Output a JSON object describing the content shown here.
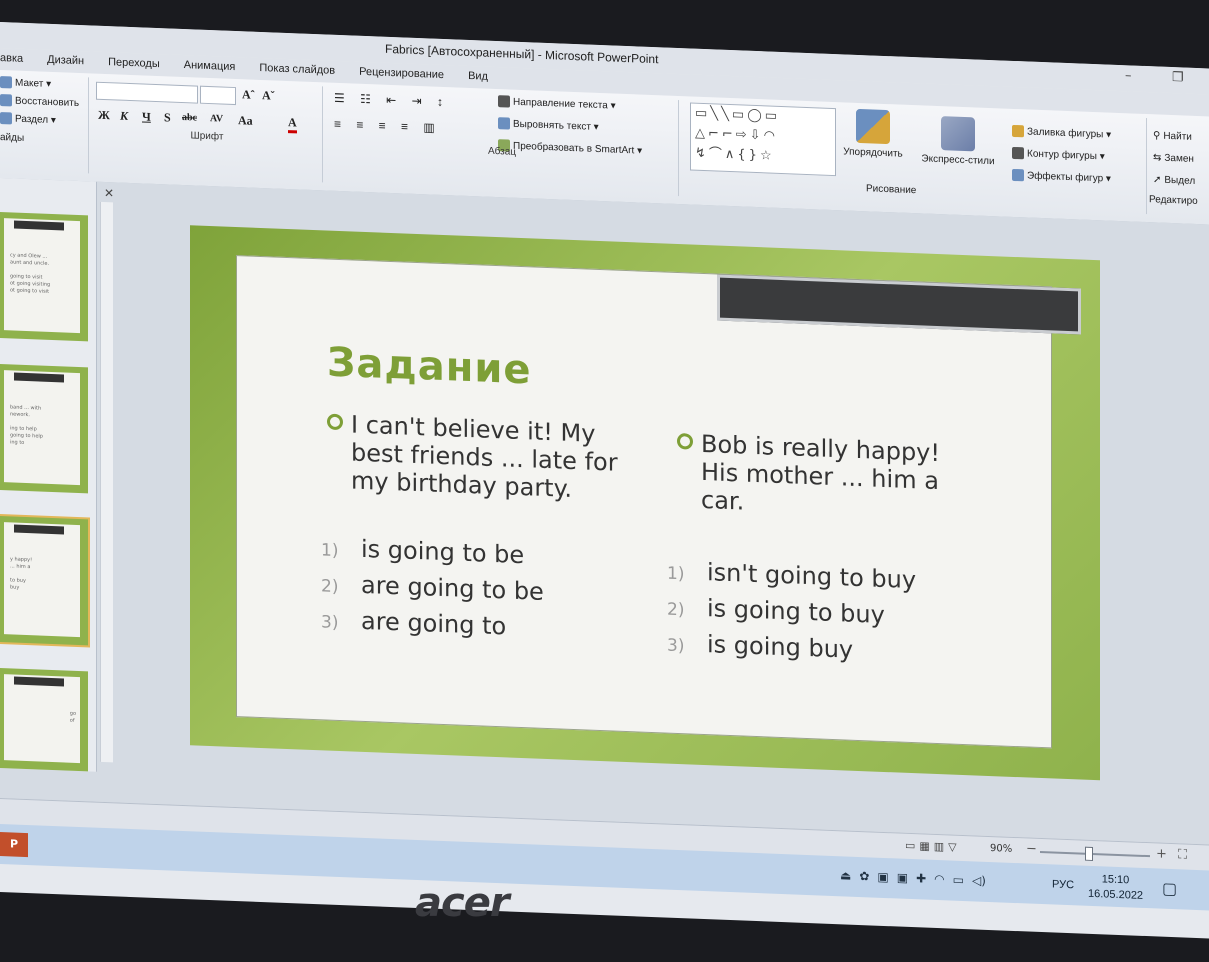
{
  "window": {
    "title": "Fabrics [Автосохраненный] - Microsoft PowerPoint",
    "minimize_glyph": "–",
    "restore_glyph": "❐"
  },
  "tabs": [
    "авка",
    "Дизайн",
    "Переходы",
    "Анимация",
    "Показ слайдов",
    "Рецензирование",
    "Вид"
  ],
  "ribbon": {
    "slides_group": {
      "layout": "Макет ▾",
      "reset": "Восстановить",
      "section": "Раздел ▾",
      "label": "айды"
    },
    "font_group": {
      "label": "Шрифт",
      "grow": "Aˆ",
      "shrink": "Aˇ",
      "bold": "Ж",
      "italic": "К",
      "underline": "Ч",
      "strike": "S",
      "abc": "abc",
      "spacing": "AV",
      "case": "Aa",
      "color": "A"
    },
    "paragraph_group": {
      "label": "Абзац",
      "text_direction": "Направление текста ▾",
      "align_text": "Выровнять текст ▾",
      "smartart": "Преобразовать в SmartArt ▾"
    },
    "drawing_group": {
      "label": "Рисование",
      "arrange": "Упорядочить",
      "quick_styles": "Экспресс-стили",
      "fill": "Заливка фигуры ▾",
      "outline": "Контур фигуры ▾",
      "effects": "Эффекты фигур ▾"
    },
    "editing_group": {
      "label": "Редактиро",
      "find": "Найти",
      "replace": "Замен",
      "select": "Выдел"
    }
  },
  "slide": {
    "heading": "Задание",
    "left_question": [
      "I can't believe it! My",
      "best friends ... late for",
      "my birthday party."
    ],
    "right_question": [
      "Bob is really happy!",
      "His mother ... him a",
      "car."
    ],
    "left_options": [
      {
        "n": "1)",
        "text": "is going to be"
      },
      {
        "n": "2)",
        "text": "are going to be"
      },
      {
        "n": "3)",
        "text": "are going to"
      }
    ],
    "right_options": [
      {
        "n": "1)",
        "text": "isn't going to buy"
      },
      {
        "n": "2)",
        "text": "is going to buy"
      },
      {
        "n": "3)",
        "text": "is going buy"
      }
    ]
  },
  "thumbnails": [
    {
      "lines": [
        "cy and Olew ...",
        "aunt and uncle.",
        "",
        "going to visit",
        "ot going visiting",
        "ot going to visit"
      ]
    },
    {
      "lines": [
        "band ... with",
        "nework.",
        "",
        "ing to help",
        "going to help",
        "ing to"
      ]
    },
    {
      "lines": [
        "y happy!",
        "... him a",
        "",
        "to buy",
        "buy"
      ]
    },
    {
      "lines": [
        "go",
        "of"
      ]
    }
  ],
  "status": {
    "zoom": "90%",
    "minus": "−",
    "plus": "+"
  },
  "taskbar": {
    "app_icon": "P",
    "language": "РУС",
    "time": "15:10",
    "date": "16.05.2022"
  },
  "bezel": {
    "brand": "acer"
  },
  "colors": {
    "accent_green": "#7e9f37",
    "ribbon_bg": "#f5f6f9",
    "taskbar": "#bfd3ea"
  }
}
